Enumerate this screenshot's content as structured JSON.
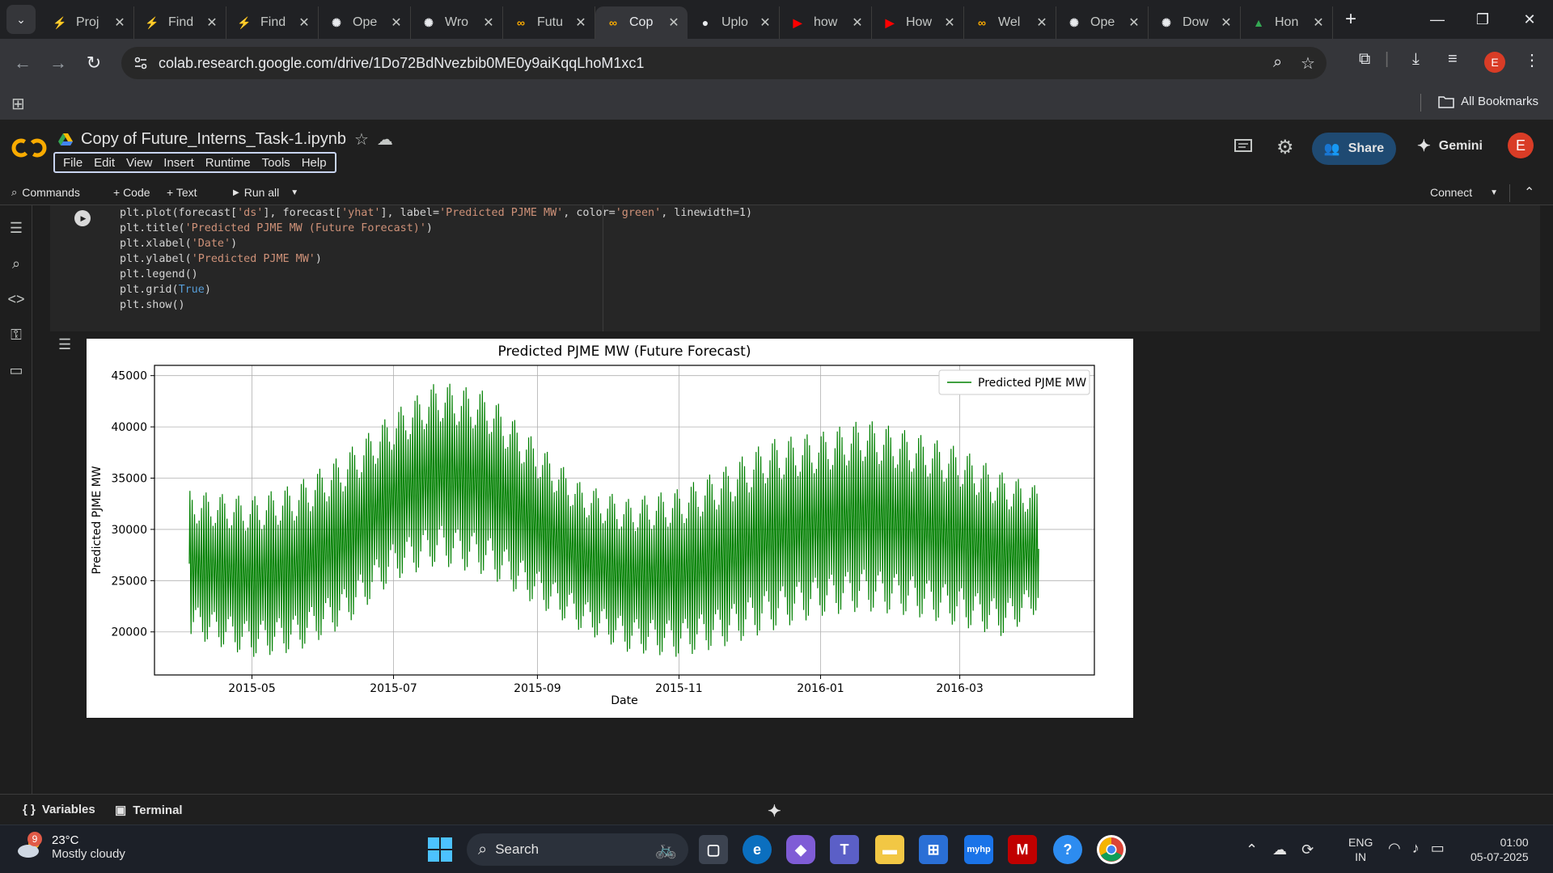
{
  "browser": {
    "tabs": [
      {
        "title": "Proj",
        "favicon": "lightning-icon",
        "color": "#f2a93b"
      },
      {
        "title": "Find",
        "favicon": "lightning-icon",
        "color": "#f2a93b"
      },
      {
        "title": "Find",
        "favicon": "lightning-icon",
        "color": "#f2a93b"
      },
      {
        "title": "Ope",
        "favicon": "openai-icon",
        "color": "#e8eaed"
      },
      {
        "title": "Wro",
        "favicon": "openai-icon",
        "color": "#e8eaed"
      },
      {
        "title": "Futu",
        "favicon": "colab-icon",
        "color": "#f9ab00"
      },
      {
        "title": "Cop",
        "favicon": "colab-icon",
        "color": "#f9ab00"
      },
      {
        "title": "Uplo",
        "favicon": "github-icon",
        "color": "#e8eaed"
      },
      {
        "title": "how",
        "favicon": "youtube-icon",
        "color": "#ff0000"
      },
      {
        "title": "How",
        "favicon": "youtube-icon",
        "color": "#ff0000"
      },
      {
        "title": "Wel",
        "favicon": "colab-icon",
        "color": "#f9ab00"
      },
      {
        "title": "Ope",
        "favicon": "openai-icon",
        "color": "#e8eaed"
      },
      {
        "title": "Dow",
        "favicon": "openai-icon",
        "color": "#e8eaed"
      },
      {
        "title": "Hon",
        "favicon": "drive-icon",
        "color": "#34a853"
      }
    ],
    "active_tab_index": 6,
    "url": "colab.research.google.com/drive/1Do72BdNvezbib0ME0y9aiKqqLhoM1xc1",
    "profile_initial": "E",
    "bookmarks_label": "All Bookmarks"
  },
  "colab": {
    "doc_title": "Copy of Future_Interns_Task-1.ipynb",
    "menu": [
      "File",
      "Edit",
      "View",
      "Insert",
      "Runtime",
      "Tools",
      "Help"
    ],
    "share_label": "Share",
    "gemini_label": "Gemini",
    "user_initial": "E",
    "toolbar": {
      "commands": "Commands",
      "code": "+ Code",
      "text": "+ Text",
      "run_all": "Run all",
      "connect": "Connect"
    },
    "code_lines": [
      "plt.plot(forecast['ds'], forecast['yhat'], label='Predicted PJME MW', color='green', linewidth=1)",
      "plt.title('Predicted PJME MW (Future Forecast)')",
      "plt.xlabel('Date')",
      "plt.ylabel('Predicted PJME MW')",
      "plt.legend()",
      "plt.grid(True)",
      "plt.show()"
    ],
    "statusbar": {
      "variables": "Variables",
      "terminal": "Terminal"
    }
  },
  "chart_data": {
    "type": "line",
    "title": "Predicted PJME MW (Future Forecast)",
    "xlabel": "Date",
    "ylabel": "Predicted PJME MW",
    "x_ticks": [
      "2015-05",
      "2015-07",
      "2015-09",
      "2015-11",
      "2016-01",
      "2016-03"
    ],
    "y_ticks": [
      "20000",
      "25000",
      "30000",
      "35000",
      "40000",
      "45000"
    ],
    "ylim": [
      15800,
      46000
    ],
    "xlim": [
      "2015-03-20",
      "2016-04-28"
    ],
    "grid": true,
    "legend_position": "top-right",
    "series": [
      {
        "name": "Predicted PJME MW",
        "color": "green",
        "x_start": "2015-04-04",
        "x_end": "2016-04-04",
        "upper_envelope": [
          [
            "2015-04-04",
            33800
          ],
          [
            "2015-05-01",
            33200
          ],
          [
            "2015-05-20",
            34500
          ],
          [
            "2015-06-10",
            37500
          ],
          [
            "2015-07-01",
            41500
          ],
          [
            "2015-07-20",
            44500
          ],
          [
            "2015-08-10",
            43500
          ],
          [
            "2015-09-01",
            38500
          ],
          [
            "2015-09-20",
            34500
          ],
          [
            "2015-10-10",
            33000
          ],
          [
            "2015-11-01",
            34000
          ],
          [
            "2015-11-20",
            36000
          ],
          [
            "2015-12-10",
            38800
          ],
          [
            "2016-01-01",
            39500
          ],
          [
            "2016-01-20",
            40800
          ],
          [
            "2016-02-10",
            39500
          ],
          [
            "2016-03-01",
            38000
          ],
          [
            "2016-03-20",
            35500
          ],
          [
            "2016-04-04",
            34200
          ]
        ],
        "lower_envelope": [
          [
            "2015-04-04",
            19500
          ],
          [
            "2015-05-01",
            17500
          ],
          [
            "2015-05-20",
            18000
          ],
          [
            "2015-06-10",
            20500
          ],
          [
            "2015-07-01",
            25000
          ],
          [
            "2015-07-20",
            26500
          ],
          [
            "2015-08-10",
            25500
          ],
          [
            "2015-09-01",
            22500
          ],
          [
            "2015-09-20",
            20000
          ],
          [
            "2015-10-10",
            18000
          ],
          [
            "2015-11-01",
            17500
          ],
          [
            "2015-11-20",
            18500
          ],
          [
            "2015-12-10",
            20000
          ],
          [
            "2016-01-01",
            21500
          ],
          [
            "2016-01-20",
            22000
          ],
          [
            "2016-02-10",
            21500
          ],
          [
            "2016-03-01",
            20500
          ],
          [
            "2016-03-20",
            19500
          ],
          [
            "2016-04-04",
            22000
          ]
        ]
      }
    ]
  },
  "taskbar": {
    "weather_temp": "23°C",
    "weather_desc": "Mostly cloudy",
    "weather_badge": "9",
    "search_placeholder": "Search",
    "lang_line1": "ENG",
    "lang_line2": "IN",
    "time": "01:00",
    "date": "05-07-2025"
  }
}
